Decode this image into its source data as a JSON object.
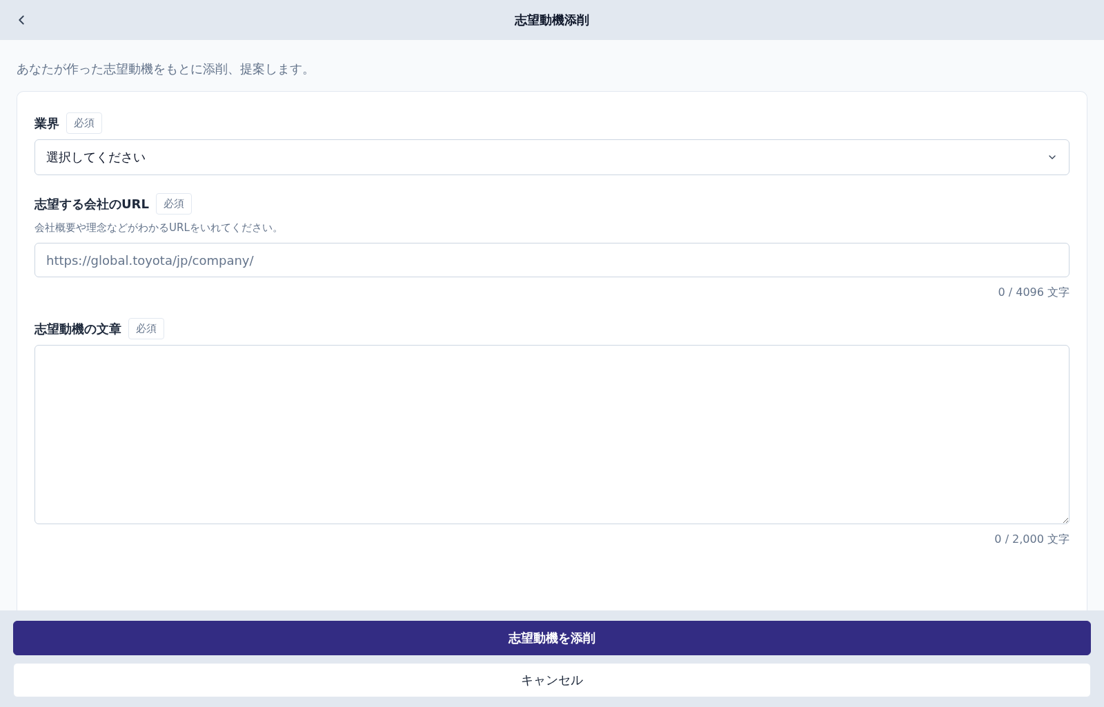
{
  "header": {
    "title": "志望動機添削"
  },
  "intro": "あなたが作った志望動機をもとに添削、提案します。",
  "fields": [
    {
      "kind": "select",
      "label": "業界",
      "badge": "必須",
      "value": "選択してください"
    },
    {
      "kind": "input",
      "label": "志望する会社のURL",
      "badge": "必須",
      "help": "会社概要や理念などがわかるURLをいれてください。",
      "placeholder": "https://global.toyota/jp/company/",
      "counter": "0 / 4096 文字"
    },
    {
      "kind": "textarea",
      "label": "志望動機の文章",
      "badge": "必須",
      "counter": "0 / 2,000 文字"
    }
  ],
  "buttons": [
    {
      "kind": "primary",
      "label": "志望動機を添削"
    },
    {
      "kind": "secondary",
      "label": "キャンセル"
    }
  ]
}
